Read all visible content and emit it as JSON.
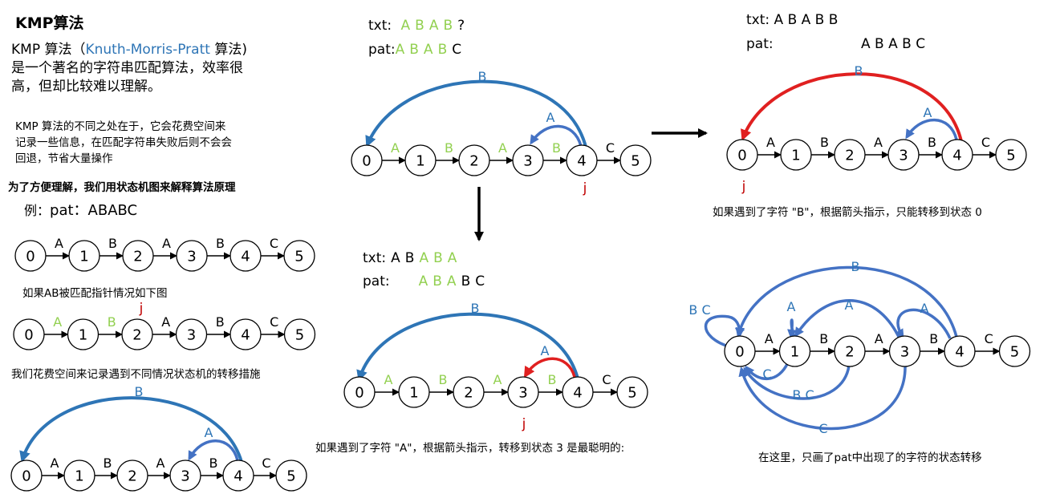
{
  "colors": {
    "blue_arc": "#2e75b6",
    "light_blue_arc": "#4472c4",
    "red_arc": "#e02020",
    "green_text": "#92d050",
    "red_text": "#c00000"
  },
  "left": {
    "title": "KMP算法",
    "intro_prefix": "KMP 算法（",
    "intro_link": "Knuth-Morris-Pratt",
    "intro_suffix": " 算法)",
    "intro_line2": "是一个著名的字符串匹配算法，效率很",
    "intro_line3": "高，但却比较难以理解。",
    "note_line1": "KMP 算法的不同之处在于，它会花费空间来",
    "note_line2": "记录一些信息，在匹配字符串失败后则不会会",
    "note_line3": "回退，节省大量操作",
    "heading": "为了方便理解，我们用状态机图来解释算法原理",
    "example_prefix": "例：",
    "example_value": "pat：ABABC",
    "matched_caption": "如果AB被匹配指针情况如下图",
    "record_caption": "我们花费空间来记录遇到不同情况状态机的转移措施"
  },
  "middle": {
    "txt_label": "txt:",
    "txt_chars": [
      "A",
      "B",
      "A",
      "B"
    ],
    "txt_unknown": "?",
    "pat_label": "pat:",
    "pat_chars": [
      "A",
      "B",
      "A",
      "B"
    ],
    "pat_last": "C",
    "txt2_label": "txt:",
    "txt2_plain": [
      "A",
      "B"
    ],
    "txt2_green": [
      "A",
      "B",
      "A"
    ],
    "pat2_label": "pat:",
    "pat2_green": [
      "A",
      "B",
      "A"
    ],
    "pat2_plain": [
      "B",
      "C"
    ],
    "caption_bottom": "如果遇到了字符 \"A\"，根据箭头指示，转移到状态 3 是最聪明的:"
  },
  "right": {
    "txt_label": "txt:",
    "txt_value": "A B A B B",
    "pat_label": "pat:",
    "pat_value": "A B A B C",
    "caption_top": "如果遇到了字符 \"B\"，根据箭头指示，只能转移到状态 0",
    "caption_bottom": "在这里，只画了pat中出现了的字符的状态转移"
  },
  "diagram": {
    "states": [
      "0",
      "1",
      "2",
      "3",
      "4",
      "5"
    ],
    "edges": [
      "A",
      "B",
      "A",
      "B",
      "C"
    ],
    "pointer": "j",
    "back_arc_B": "B",
    "back_arc_A": "A",
    "self_loop": "B C",
    "back_C": "C",
    "back_BC": "B C"
  }
}
